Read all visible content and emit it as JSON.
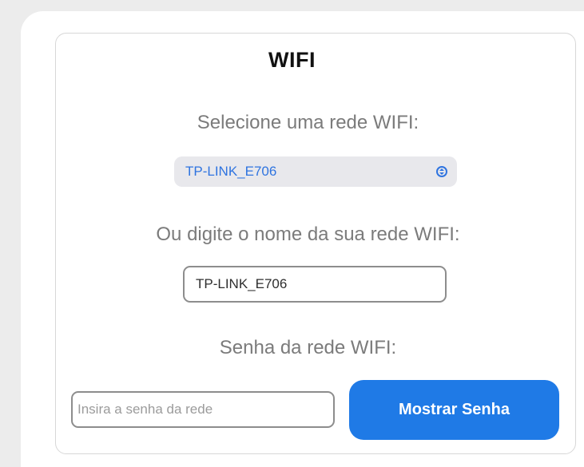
{
  "page": {
    "title": "WIFI"
  },
  "network_select": {
    "label": "Selecione uma rede WIFI:",
    "selected_value": "TP-LINK_E706",
    "icon": "select-arrows-icon"
  },
  "network_name": {
    "label": "Ou digite o nome da sua rede WIFI:",
    "value": "TP-LINK_E706"
  },
  "password": {
    "label": "Senha da rede WIFI:",
    "placeholder": "Insira a senha da rede",
    "value": ""
  },
  "buttons": {
    "show_password": "Mostrar Senha"
  },
  "colors": {
    "accent": "#1f7ae6",
    "select_text": "#2f74e0",
    "label_text": "#7b7b7b",
    "background": "#ececec"
  }
}
